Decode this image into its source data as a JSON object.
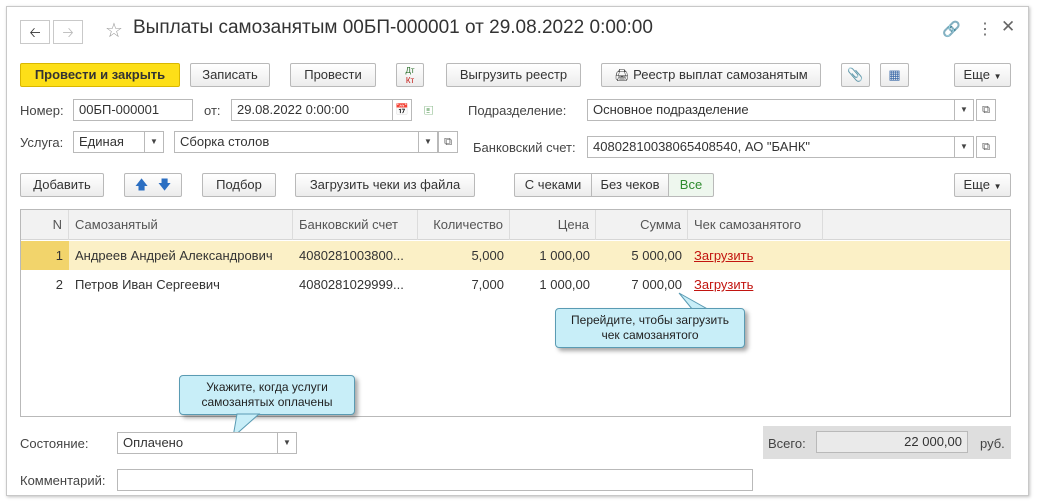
{
  "window": {
    "title": "Выплаты самозанятым 00БП-000001 от 29.08.2022 0:00:00"
  },
  "toolbar": {
    "post_close": "Провести и закрыть",
    "save": "Записать",
    "post": "Провести",
    "dt_kt_top": "Дт",
    "dt_kt_bottom": "Кт",
    "export_register": "Выгрузить реестр",
    "payments_register": "Реестр выплат самозанятым",
    "more": "Еще"
  },
  "form": {
    "number_label": "Номер:",
    "number_value": "00БП-000001",
    "date_label": "от:",
    "date_value": "29.08.2022  0:00:00",
    "division_label": "Подразделение:",
    "division_value": "Основное подразделение",
    "service_label": "Услуга:",
    "service_type_value": "Единая",
    "service_value": "Сборка столов",
    "bank_label": "Банковский счет:",
    "bank_value": "40802810038065408540, АО \"БАНК\""
  },
  "table_toolbar": {
    "add": "Добавить",
    "select": "Подбор",
    "load_receipts": "Загрузить чеки из файла",
    "filter_with": "С чеками",
    "filter_without": "Без чеков",
    "filter_all": "Все",
    "more": "Еще"
  },
  "table": {
    "headers": [
      "N",
      "Самозанятый",
      "Банковский счет",
      "Количество",
      "Цена",
      "Сумма",
      "Чек самозанятого"
    ],
    "rows": [
      {
        "n": "1",
        "name": "Андреев Андрей Александрович",
        "account": "4080281003800...",
        "qty": "5,000",
        "price": "1 000,00",
        "sum": "5 000,00",
        "receipt": "Загрузить"
      },
      {
        "n": "2",
        "name": "Петров Иван Сергеевич",
        "account": "4080281029999...",
        "qty": "7,000",
        "price": "1 000,00",
        "sum": "7 000,00",
        "receipt": "Загрузить"
      }
    ]
  },
  "tooltips": {
    "receipt_tip_line1": "Перейдите, чтобы загрузить",
    "receipt_tip_line2": "чек самозанятого",
    "status_tip_line1": "Укажите, когда услуги",
    "status_tip_line2": "самозанятых оплачены"
  },
  "footer": {
    "status_label": "Состояние:",
    "status_value": "Оплачено",
    "total_label": "Всего:",
    "total_value": "22 000,00",
    "currency": "руб.",
    "comment_label": "Комментарий:",
    "comment_value": ""
  },
  "colors": {
    "primary_button": "#fddf18",
    "selected_row": "#fbf0c6",
    "link": "#c2140f",
    "tooltip_bg": "#c8eef8",
    "filter_all_text": "#2e8b2e"
  }
}
